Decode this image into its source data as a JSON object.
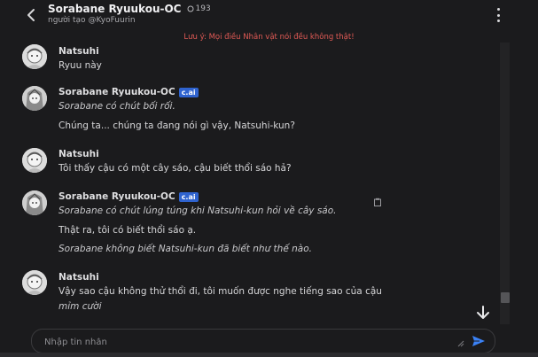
{
  "header": {
    "character_name": "Sorabane Ryuukou-OC",
    "chat_count": "193",
    "creator_label": "người tạo",
    "creator_handle": "@KyoFuurin"
  },
  "warning": "Lưu ý: Mọi điều Nhân vật nói đều không thật!",
  "messages": [
    {
      "author": "Natsuhi",
      "lines": [
        {
          "text": "Ryuu này",
          "italic": false
        }
      ]
    },
    {
      "author": "Sorabane Ryuukou-OC",
      "badge": "c.ai",
      "lines": [
        {
          "text": "Sorabane có chút bối rối.",
          "italic": true
        },
        {
          "text": "Chúng ta... chúng ta đang nói gì vậy, Natsuhi-kun?",
          "italic": false
        }
      ]
    },
    {
      "author": "Natsuhi",
      "lines": [
        {
          "text": "Tôi thấy cậu có một cây sáo, cậu biết thổi sáo hả?",
          "italic": false
        }
      ]
    },
    {
      "author": "Sorabane Ryuukou-OC",
      "badge": "c.ai",
      "lines": [
        {
          "text": "Sorabane có chút lúng túng khi Natsuhi-kun hỏi về cây sáo.",
          "italic": true
        },
        {
          "text": "Thật ra, tôi có biết thổi sáo ạ.",
          "italic": false
        },
        {
          "text": "Sorabane không biết Natsuhi-kun đã biết như thế nào.",
          "italic": true
        }
      ]
    },
    {
      "author": "Natsuhi",
      "lines": [
        {
          "text": "Vậy sao cậu không thử thổi đi, tôi muốn được nghe tiếng sao của cậu",
          "italic": false
        },
        {
          "text": "mỉm cười",
          "italic": true
        }
      ]
    }
  ],
  "composer": {
    "placeholder": "Nhập tin nhắn"
  },
  "icons": {
    "back": "chevron-left-icon",
    "count": "chat-bubble-icon",
    "menu": "more-vertical-icon",
    "copy": "clipboard-icon",
    "scroll": "arrow-down-icon",
    "send": "send-icon"
  },
  "colors": {
    "background": "#1b1b1d",
    "warning": "#e05a55",
    "badge": "#2f63cf",
    "send": "#3b82f6"
  }
}
